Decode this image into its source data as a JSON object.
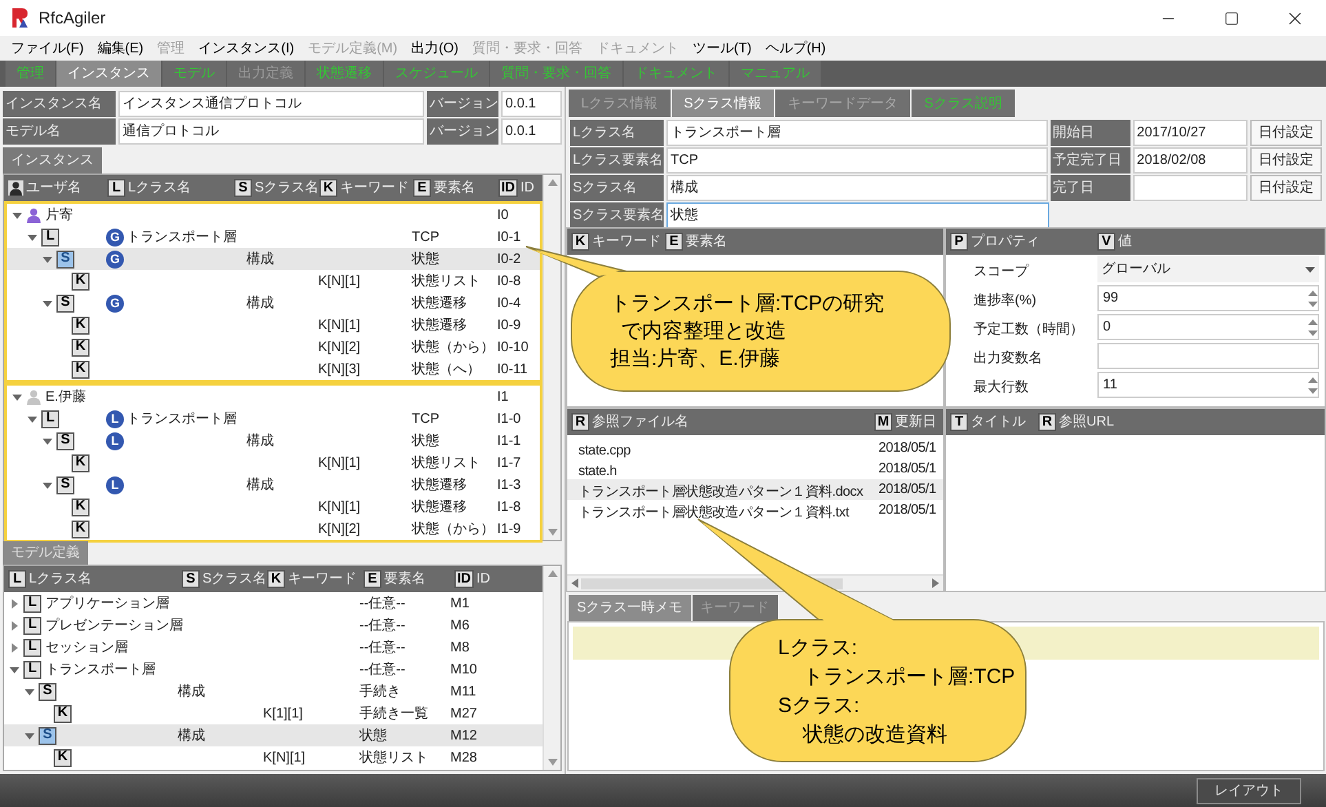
{
  "window": {
    "title": "RfcAgiler"
  },
  "menu": [
    {
      "label": "ファイル(F)",
      "disabled": false
    },
    {
      "label": "編集(E)",
      "disabled": false
    },
    {
      "label": "管理",
      "disabled": true
    },
    {
      "label": "インスタンス(I)",
      "disabled": false
    },
    {
      "label": "モデル定義(M)",
      "disabled": true
    },
    {
      "label": "出力(O)",
      "disabled": false
    },
    {
      "label": "質問・要求・回答",
      "disabled": true
    },
    {
      "label": "ドキュメント",
      "disabled": true
    },
    {
      "label": "ツール(T)",
      "disabled": false
    },
    {
      "label": "ヘルプ(H)",
      "disabled": false
    }
  ],
  "main_tabs": [
    {
      "label": "管理",
      "selected": false,
      "disabled": false
    },
    {
      "label": "インスタンス",
      "selected": true,
      "disabled": false
    },
    {
      "label": "モデル",
      "selected": false,
      "disabled": false
    },
    {
      "label": "出力定義",
      "selected": false,
      "disabled": true
    },
    {
      "label": "状態遷移",
      "selected": false,
      "disabled": false
    },
    {
      "label": "スケジュール",
      "selected": false,
      "disabled": false
    },
    {
      "label": "質問・要求・回答",
      "selected": false,
      "disabled": false
    },
    {
      "label": "ドキュメント",
      "selected": false,
      "disabled": false
    },
    {
      "label": "マニュアル",
      "selected": false,
      "disabled": false
    }
  ],
  "instance_form": [
    {
      "label": "インスタンス名",
      "value": "インスタンス通信プロトコル",
      "version_label": "バージョン",
      "version": "0.0.1"
    },
    {
      "label": "モデル名",
      "value": "通信プロトコル",
      "version_label": "バージョン",
      "version": "0.0.1"
    }
  ],
  "instance_panel": {
    "tab": "インスタンス",
    "columns": [
      {
        "kind": "user",
        "label": "ユーザ名"
      },
      {
        "kind": "badge",
        "badge": "L",
        "label": "Lクラス名"
      },
      {
        "kind": "badge",
        "badge": "S",
        "label": "Sクラス名"
      },
      {
        "kind": "badge",
        "badge": "K",
        "label": "キーワード"
      },
      {
        "kind": "badge",
        "badge": "E",
        "label": "要素名"
      },
      {
        "kind": "badge",
        "badge": "ID",
        "label": "ID"
      }
    ],
    "groups": [
      {
        "kind": "user",
        "name": "片寄",
        "id": "I0",
        "color": "#8b63d6",
        "expanded": true,
        "selected": false,
        "children": [
          {
            "kind": "class",
            "badge": "L",
            "scope": "G",
            "lclass": "トランスポート層",
            "element": "TCP",
            "id": "I0-1",
            "expanded": true,
            "selected": false,
            "children": [
              {
                "kind": "class",
                "badge": "S",
                "scope": "G",
                "sclass": "構成",
                "element": "状態",
                "id": "I0-2",
                "expanded": true,
                "selected": true,
                "children": [
                  {
                    "kind": "class",
                    "badge": "K",
                    "keyword": "K[N][1]",
                    "element": "状態リスト",
                    "id": "I0-8",
                    "selected": false
                  }
                ]
              },
              {
                "kind": "class",
                "badge": "S",
                "scope": "G",
                "sclass": "構成",
                "element": "状態遷移",
                "id": "I0-4",
                "expanded": true,
                "selected": false,
                "children": [
                  {
                    "kind": "class",
                    "badge": "K",
                    "keyword": "K[N][1]",
                    "element": "状態遷移",
                    "id": "I0-9",
                    "selected": false
                  },
                  {
                    "kind": "class",
                    "badge": "K",
                    "keyword": "K[N][2]",
                    "element": "状態（から）",
                    "id": "I0-10",
                    "selected": false
                  },
                  {
                    "kind": "class",
                    "badge": "K",
                    "keyword": "K[N][3]",
                    "element": "状態（へ）",
                    "id": "I0-11",
                    "selected": false
                  }
                ]
              }
            ]
          }
        ]
      },
      {
        "kind": "user",
        "name": "E.伊藤",
        "id": "I1",
        "color": "#c4c4c4",
        "expanded": true,
        "selected": false,
        "children": [
          {
            "kind": "class",
            "badge": "L",
            "scope": "L",
            "lclass": "トランスポート層",
            "element": "TCP",
            "id": "I1-0",
            "expanded": true,
            "selected": false,
            "children": [
              {
                "kind": "class",
                "badge": "S",
                "scope": "L",
                "sclass": "構成",
                "element": "状態",
                "id": "I1-1",
                "expanded": true,
                "selected": false,
                "children": [
                  {
                    "kind": "class",
                    "badge": "K",
                    "keyword": "K[N][1]",
                    "element": "状態リスト",
                    "id": "I1-7",
                    "selected": false
                  }
                ]
              },
              {
                "kind": "class",
                "badge": "S",
                "scope": "L",
                "sclass": "構成",
                "element": "状態遷移",
                "id": "I1-3",
                "expanded": true,
                "selected": false,
                "children": [
                  {
                    "kind": "class",
                    "badge": "K",
                    "keyword": "K[N][1]",
                    "element": "状態遷移",
                    "id": "I1-8",
                    "selected": false
                  },
                  {
                    "kind": "class",
                    "badge": "K",
                    "keyword": "K[N][2]",
                    "element": "状態（から）",
                    "id": "I1-9",
                    "selected": false
                  }
                ]
              }
            ]
          }
        ]
      }
    ]
  },
  "model_panel": {
    "tab": "モデル定義",
    "columns": [
      {
        "badge": "L",
        "label": "Lクラス名"
      },
      {
        "badge": "S",
        "label": "Sクラス名"
      },
      {
        "badge": "K",
        "label": "キーワード"
      },
      {
        "badge": "E",
        "label": "要素名"
      },
      {
        "badge": "ID",
        "label": "ID"
      }
    ],
    "rows": [
      {
        "badge": "L",
        "lclass": "アプリケーション層",
        "element": "--任意--",
        "id": "M1",
        "expanded": false,
        "selected": false
      },
      {
        "badge": "L",
        "lclass": "プレゼンテーション層",
        "element": "--任意--",
        "id": "M6",
        "expanded": false,
        "selected": false
      },
      {
        "badge": "L",
        "lclass": "セッション層",
        "element": "--任意--",
        "id": "M8",
        "expanded": false,
        "selected": false
      },
      {
        "badge": "L",
        "lclass": "トランスポート層",
        "element": "--任意--",
        "id": "M10",
        "expanded": true,
        "selected": false,
        "children": [
          {
            "badge": "S",
            "sclass": "構成",
            "element": "手続き",
            "id": "M11",
            "expanded": true,
            "selected": false,
            "children": [
              {
                "badge": "K",
                "keyword": "K[1][1]",
                "element": "手続き一覧",
                "id": "M27",
                "selected": false
              }
            ]
          },
          {
            "badge": "S",
            "sclass": "構成",
            "element": "状態",
            "id": "M12",
            "expanded": true,
            "selected": true,
            "children": [
              {
                "badge": "K",
                "keyword": "K[N][1]",
                "element": "状態リスト",
                "id": "M28",
                "selected": false
              }
            ]
          }
        ]
      }
    ]
  },
  "detail_tabs": [
    {
      "label": "Lクラス情報",
      "selected": false,
      "disabled": true
    },
    {
      "label": "Sクラス情報",
      "selected": true,
      "disabled": false
    },
    {
      "label": "キーワードデータ",
      "selected": false,
      "disabled": true
    },
    {
      "label": "Sクラス説明",
      "selected": false,
      "disabled": false
    }
  ],
  "detail_form": [
    {
      "label": "Lクラス名",
      "value": "トランスポート層",
      "focused": false,
      "date_label": "開始日",
      "date": "2017/10/27",
      "button": "日付設定"
    },
    {
      "label": "Lクラス要素名",
      "value": "TCP",
      "focused": false,
      "date_label": "予定完了日",
      "date": "2018/02/08",
      "button": "日付設定"
    },
    {
      "label": "Sクラス名",
      "value": "構成",
      "focused": false,
      "date_label": "完了日",
      "button": "日付設定"
    },
    {
      "label": "Sクラス要素名",
      "value": "状態",
      "focused": true
    }
  ],
  "keywords": {
    "columns": [
      {
        "badge": "K",
        "label": "キーワード"
      },
      {
        "badge": "E",
        "label": "要素名"
      }
    ]
  },
  "properties": {
    "columns": [
      {
        "badge": "P",
        "label": "プロパティ"
      },
      {
        "badge": "V",
        "label": "値"
      }
    ],
    "rows": [
      {
        "kind": "select",
        "name": "スコープ",
        "value": "グローバル"
      },
      {
        "kind": "spin",
        "name": "進捗率(%)",
        "value": "99"
      },
      {
        "kind": "spin",
        "name": "予定工数（時間）",
        "value": "0"
      },
      {
        "kind": "text",
        "name": "出力変数名"
      },
      {
        "kind": "spin",
        "name": "最大行数",
        "value": "11"
      }
    ]
  },
  "references": {
    "columns": [
      {
        "badge": "R",
        "label": "参照ファイル名"
      },
      {
        "badge": "M",
        "label": "更新日"
      }
    ],
    "rows": [
      {
        "file": "state.cpp",
        "date": "2018/05/1",
        "selected": false
      },
      {
        "file": "state.h",
        "date": "2018/05/1",
        "selected": false
      },
      {
        "file": "トランスポート層状態改造パターン１資料.docx",
        "date": "2018/05/1",
        "selected": true
      },
      {
        "file": "トランスポート層状態改造パターン１資料.txt",
        "date": "2018/05/1",
        "selected": false
      }
    ]
  },
  "urls": {
    "columns": [
      {
        "badge": "T",
        "label": "タイトル"
      },
      {
        "badge": "R",
        "label": "参照URL"
      }
    ]
  },
  "memo_tabs": [
    {
      "label": "Sクラス一時メモ",
      "selected": true,
      "disabled": false
    },
    {
      "label": "キーワード",
      "selected": false,
      "disabled": true
    }
  ],
  "status_bar": {
    "button": "レイアウト"
  },
  "callout_top": {
    "lines": [
      "トランスポート層:TCPの研究",
      "で内容整理と改造",
      "担当:片寄、E.伊藤"
    ]
  },
  "callout_bottom": {
    "sections": [
      {
        "heading": "Lクラス:",
        "detail": "トランスポート層:TCP"
      },
      {
        "heading": "Sクラス:",
        "detail": "状態の改造資料"
      }
    ]
  }
}
